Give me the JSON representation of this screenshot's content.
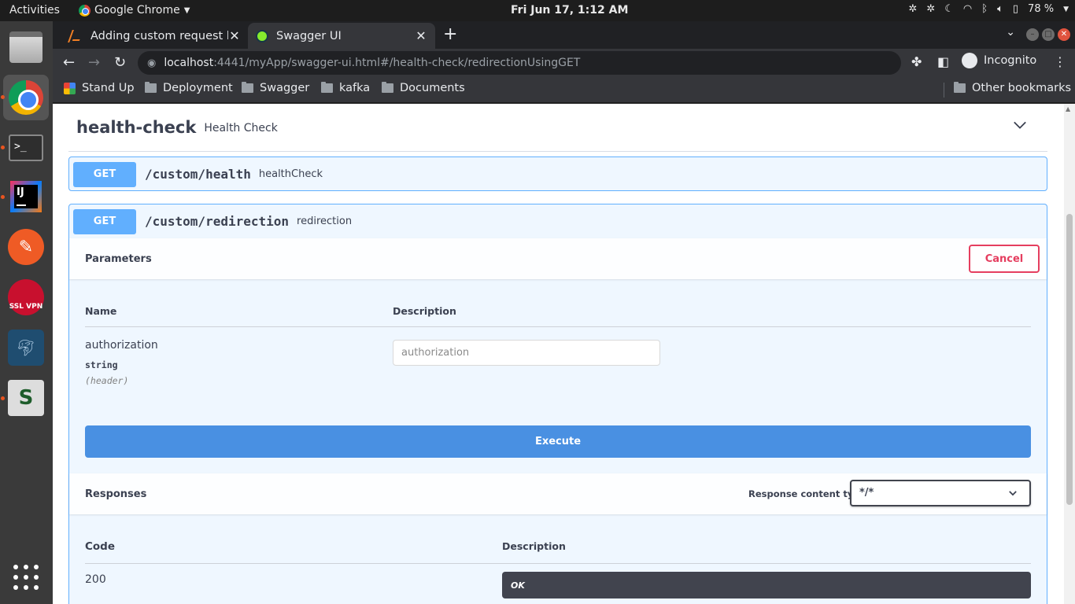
{
  "topbar": {
    "activities": "Activities",
    "app_name": "Google Chrome",
    "clock": "Fri Jun 17,  1:12 AM",
    "battery": "78 %"
  },
  "browser": {
    "tabs": [
      {
        "title": "Adding custom request he",
        "active": false
      },
      {
        "title": "Swagger UI",
        "active": true
      }
    ],
    "url_host": "localhost",
    "url_rest": ":4441/myApp/swagger-ui.html#/health-check/redirectionUsingGET",
    "profile_label": "Incognito",
    "bookmarks": [
      "Stand Up",
      "Deployment",
      "Swagger",
      "kafka",
      "Documents"
    ],
    "other_bookmarks": "Other bookmarks"
  },
  "swagger": {
    "tag": {
      "name": "health-check",
      "description": "Health Check"
    },
    "operations": [
      {
        "method": "GET",
        "path": "/custom/health",
        "summary": "healthCheck"
      },
      {
        "method": "GET",
        "path": "/custom/redirection",
        "summary": "redirection"
      }
    ],
    "parameters": {
      "title": "Parameters",
      "cancel_label": "Cancel",
      "col_name": "Name",
      "col_description": "Description",
      "items": [
        {
          "name": "authorization",
          "type": "string",
          "in": "(header)",
          "placeholder": "authorization"
        }
      ]
    },
    "execute_label": "Execute",
    "responses": {
      "title": "Responses",
      "content_type_label": "Response content type",
      "content_type_value": "*/*",
      "col_code": "Code",
      "col_description": "Description",
      "rows": [
        {
          "code": "200",
          "description": "OK"
        }
      ]
    }
  }
}
